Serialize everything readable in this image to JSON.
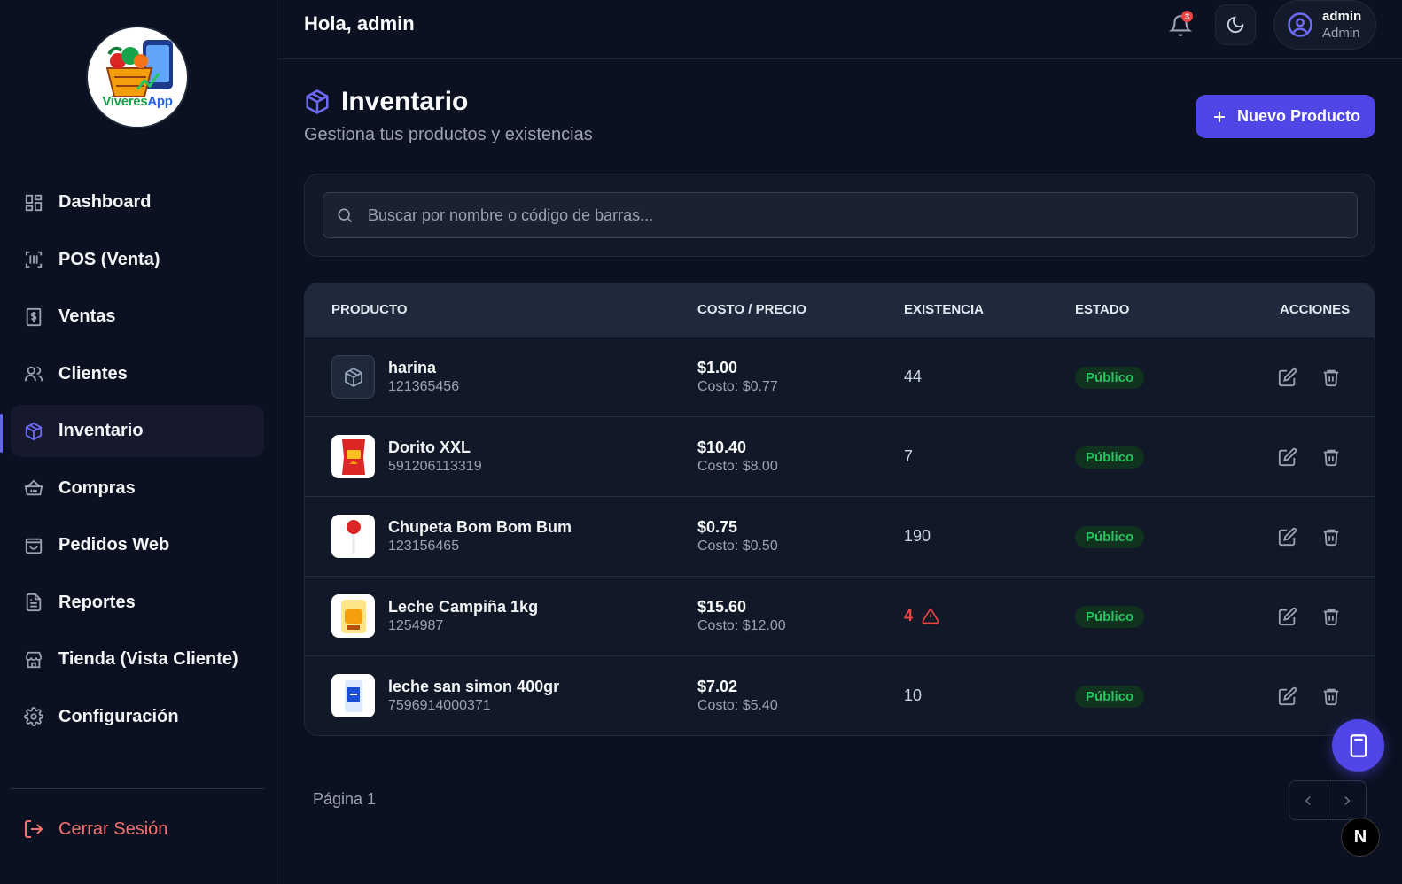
{
  "sidebar": {
    "logo_text_a": "Viveres",
    "logo_text_b": "App",
    "items": [
      {
        "label": "Dashboard",
        "icon": "dashboard-grid-icon"
      },
      {
        "label": "POS (Venta)",
        "icon": "barcode-scan-icon"
      },
      {
        "label": "Ventas",
        "icon": "dollar-receipt-icon"
      },
      {
        "label": "Clientes",
        "icon": "users-icon"
      },
      {
        "label": "Inventario",
        "icon": "package-icon",
        "active": true
      },
      {
        "label": "Compras",
        "icon": "basket-icon"
      },
      {
        "label": "Pedidos Web",
        "icon": "shopping-bag-icon"
      },
      {
        "label": "Reportes",
        "icon": "file-text-icon"
      },
      {
        "label": "Tienda (Vista Cliente)",
        "icon": "store-icon"
      },
      {
        "label": "Configuración",
        "icon": "gear-icon"
      }
    ],
    "logout_label": "Cerrar Sesión"
  },
  "header": {
    "greeting": "Hola, admin",
    "notification_count": "3",
    "user_name": "admin",
    "user_role": "Admin"
  },
  "page": {
    "title": "Inventario",
    "subtitle": "Gestiona tus productos y existencias",
    "new_button": "Nuevo Producto"
  },
  "search": {
    "placeholder": "Buscar por nombre o código de barras..."
  },
  "table": {
    "columns": [
      "PRODUCTO",
      "COSTO / PRECIO",
      "EXISTENCIA",
      "ESTADO",
      "ACCIONES"
    ],
    "rows": [
      {
        "name": "harina",
        "code": "121365456",
        "price": "$1.00",
        "cost": "Costo: $0.77",
        "stock": "44",
        "low": false,
        "status": "Público"
      },
      {
        "name": "Dorito XXL",
        "code": "591206113319",
        "price": "$10.40",
        "cost": "Costo: $8.00",
        "stock": "7",
        "low": false,
        "status": "Público"
      },
      {
        "name": "Chupeta Bom Bom Bum",
        "code": "123156465",
        "price": "$0.75",
        "cost": "Costo: $0.50",
        "stock": "190",
        "low": false,
        "status": "Público"
      },
      {
        "name": "Leche Campiña 1kg",
        "code": "1254987",
        "price": "$15.60",
        "cost": "Costo: $12.00",
        "stock": "4",
        "low": true,
        "status": "Público"
      },
      {
        "name": "leche san simon 400gr",
        "code": "7596914000371",
        "price": "$7.02",
        "cost": "Costo: $5.40",
        "stock": "10",
        "low": false,
        "status": "Público"
      }
    ]
  },
  "pagination": {
    "label": "Página 1"
  },
  "floating": {
    "next_badge": "N"
  },
  "colors": {
    "accent": "#4f46e5",
    "danger": "#ef4444",
    "success": "#22c55e",
    "background": "#0b1120"
  }
}
